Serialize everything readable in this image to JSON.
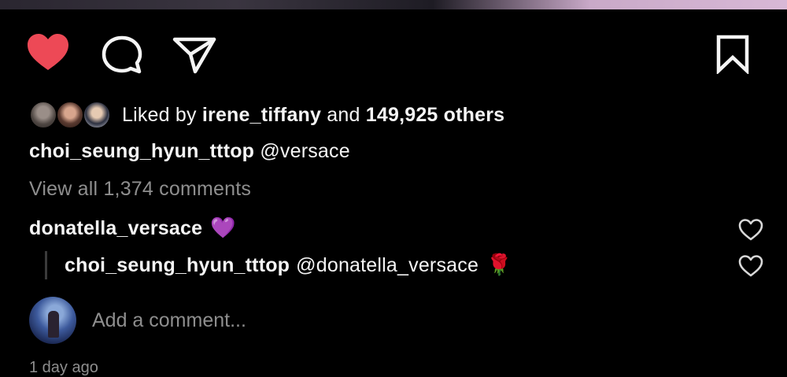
{
  "post": {
    "actions": {
      "like_icon": "heart-filled-icon",
      "comment_icon": "speech-bubble-icon",
      "share_icon": "paper-plane-icon",
      "save_icon": "bookmark-icon",
      "like_color": "#ed4956"
    },
    "likes": {
      "prefix": "Liked by",
      "first_user": "irene_tiffany",
      "connector": "and",
      "others": "149,925 others"
    },
    "caption": {
      "username": "choi_seung_hyun_tttop",
      "text": "@versace"
    },
    "view_all_comments": "View all 1,374 comments",
    "comments": [
      {
        "username": "donatella_versace",
        "emoji": "💜"
      }
    ],
    "replies": [
      {
        "username": "choi_seung_hyun_tttop",
        "text": "@donatella_versace",
        "emoji": "🌹"
      }
    ],
    "add_comment": {
      "placeholder": "Add a comment..."
    },
    "timestamp": "1 day ago"
  }
}
